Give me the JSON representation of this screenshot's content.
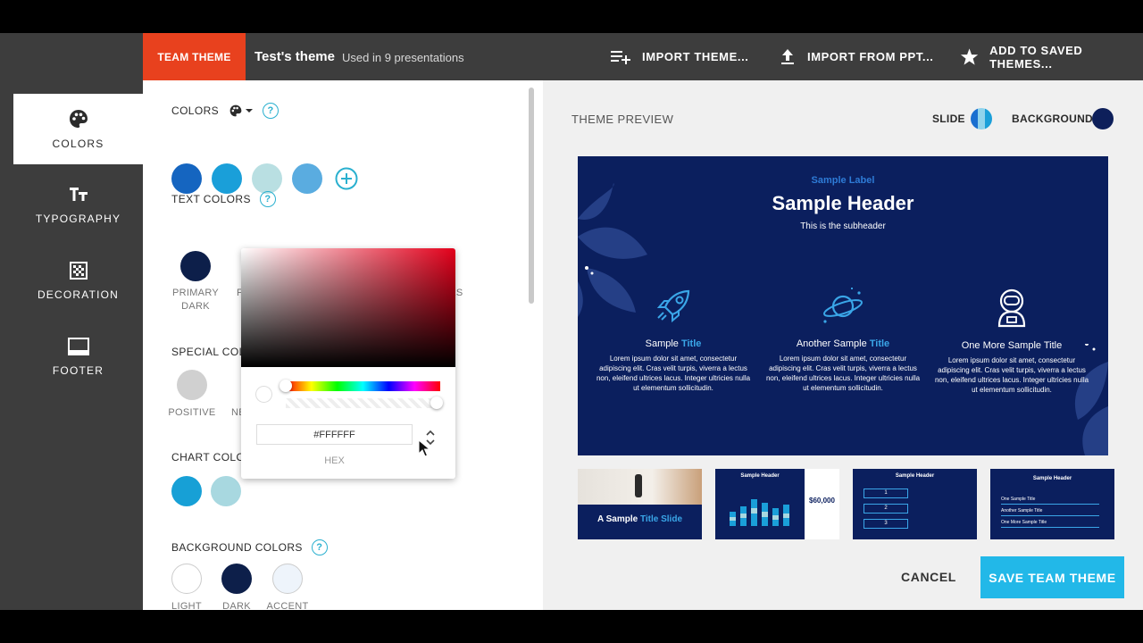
{
  "header": {
    "team_tab": "TEAM THEME",
    "theme_name": "Test's theme",
    "used_in": "Used in 9 presentations",
    "import_theme": "IMPORT THEME...",
    "import_ppt": "IMPORT FROM PPT...",
    "add_saved": "ADD TO SAVED THEMES..."
  },
  "sidebar": {
    "items": [
      {
        "label": "COLORS",
        "icon": "palette-icon",
        "active": true
      },
      {
        "label": "TYPOGRAPHY",
        "icon": "typography-icon",
        "active": false
      },
      {
        "label": "DECORATION",
        "icon": "decoration-icon",
        "active": false
      },
      {
        "label": "FOOTER",
        "icon": "footer-icon",
        "active": false
      }
    ]
  },
  "settings": {
    "colors": {
      "title": "COLORS",
      "swatches": [
        "#1565c0",
        "#1a9fd9",
        "#b9dfe2",
        "#5aace0"
      ]
    },
    "text_colors": {
      "title": "TEXT COLORS",
      "swatches": [
        {
          "color": "#0d1f4a",
          "label_line1": "PRIMARY",
          "label_line2": "DARK"
        },
        {
          "color": "#ffffff",
          "label_line1": "F",
          "label_line2": ""
        },
        {
          "color": "#353e72",
          "label_line1": "",
          "label_line2": ""
        },
        {
          "color": "#e2e2e2",
          "label_line1": "",
          "label_line2": ""
        },
        {
          "color": "#1cb9e5",
          "label_line1": "NKS",
          "label_line2": ""
        }
      ]
    },
    "special_colors": {
      "title": "SPECIAL COLO",
      "swatches": [
        {
          "color": "#d0d0d0",
          "label": "POSITIVE"
        },
        {
          "color": "#ffffff",
          "label": "NE"
        }
      ]
    },
    "chart_colors": {
      "title": "CHART COLOR",
      "swatches": [
        "#17a0d6",
        "#a8d8e0"
      ]
    },
    "background_colors": {
      "title": "BACKGROUND COLORS",
      "swatches": [
        {
          "color": "#ffffff",
          "label": "LIGHT"
        },
        {
          "color": "#0d1f4a",
          "label": "DARK"
        },
        {
          "color": "#eef4fb",
          "label": "ACCENT"
        }
      ]
    }
  },
  "picker": {
    "hex_value": "#FFFFFF",
    "hex_label": "HEX",
    "hue_color": "#e3001b",
    "alpha_percent": 100
  },
  "preview": {
    "title": "THEME PREVIEW",
    "slide_label": "SLIDE",
    "background_label": "BACKGROUND",
    "background_color": "#0d1f4a",
    "slide": {
      "label": "Sample Label",
      "header": "Sample Header",
      "subheader": "This is the subheader",
      "features": [
        {
          "icon": "rocket-icon",
          "title_plain": "Sample ",
          "title_accent": "Title",
          "body": "Lorem ipsum dolor sit amet, consectetur adipiscing elit. Cras velit turpis, viverra a lectus non, eleifend ultrices lacus. Integer ultricies nulla ut elementum sollicitudin."
        },
        {
          "icon": "planet-icon",
          "title_plain": "Another Sample ",
          "title_accent": "Title",
          "body": "Lorem ipsum dolor sit amet, consectetur adipiscing elit. Cras velit turpis, viverra a lectus non, eleifend ultrices lacus. Integer ultricies nulla ut elementum sollicitudin."
        },
        {
          "icon": "astronaut-icon",
          "title_plain": "One More Sample Title",
          "title_accent": "",
          "body": "Lorem ipsum dolor sit amet, consectetur adipiscing elit. Cras velit turpis, viverra a lectus non, eleifend ultrices lacus. Integer ultricies nulla ut elementum sollicitudin."
        }
      ]
    },
    "thumbnails": [
      {
        "title_plain": "A Sample ",
        "title_accent": "Title Slide"
      },
      {
        "title": "Sample Header",
        "stat": "$60,000"
      },
      {
        "title": "Sample Header",
        "steps": [
          "1",
          "2",
          "3"
        ]
      },
      {
        "title": "Sample Header",
        "items": [
          "One Sample Title",
          "Another Sample Title",
          "One More Sample Title"
        ]
      }
    ]
  },
  "actions": {
    "cancel": "CANCEL",
    "save": "SAVE TEAM THEME"
  }
}
